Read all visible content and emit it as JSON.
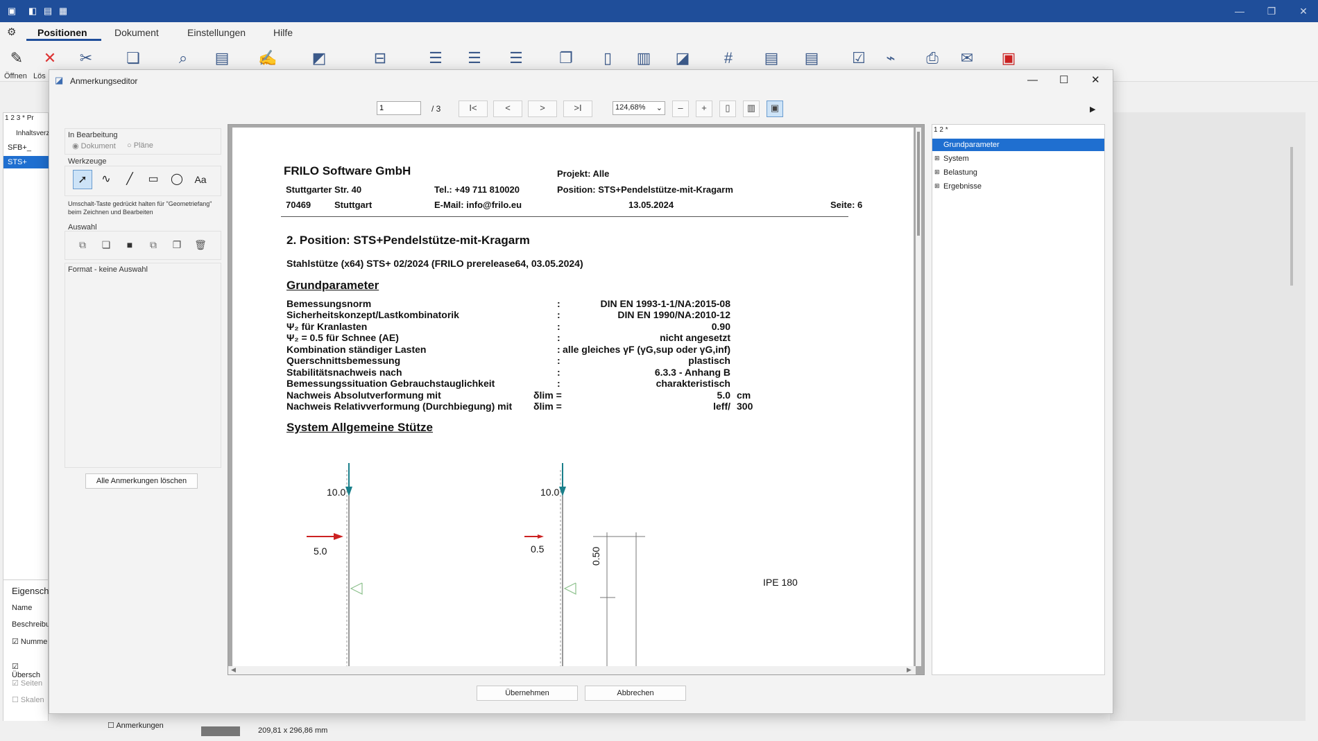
{
  "app": {
    "menu": [
      "Positionen",
      "Dokument",
      "Einstellungen",
      "Hilfe"
    ],
    "ribbon_labels": [
      "Öffnen",
      "Lös"
    ],
    "left_tabs": [
      "1",
      "2",
      "3",
      "*",
      "Pr"
    ],
    "left_tree": [
      "Inhaltsverz",
      "SFB+_",
      "STS+"
    ],
    "properties": {
      "title": "Eigensch",
      "rows": [
        "Name",
        "Beschreibu",
        "Numme",
        "Übersch",
        "Seiten",
        "Skalen"
      ]
    },
    "status": {
      "annotations_label": "Anmerkungen",
      "page_size": "209,81 x 296,86 mm"
    }
  },
  "dialog": {
    "title": "Anmerkungseditor",
    "toolbar": {
      "page_input": "1",
      "page_total": "/ 3",
      "zoom": "124,68%",
      "first": "I<",
      "prev": "<",
      "next": ">",
      "last": ">I",
      "minus": "–",
      "plus": "+"
    },
    "tools": {
      "in_bearbeitung": "In Bearbeitung",
      "radio_dokument": "Dokument",
      "radio_plaene": "Pläne",
      "werkzeuge": "Werkzeuge",
      "text_tool": "Aa",
      "hint_line1": "Umschalt-Taste gedrückt halten für \"Geometriefang\"",
      "hint_line2": "beim Zeichnen und  Bearbeiten",
      "auswahl": "Auswahl",
      "format": "Format - keine Auswahl",
      "clear_button": "Alle Anmerkungen löschen"
    },
    "tree": {
      "tabs": [
        "1",
        "2",
        "*"
      ],
      "items": [
        "Grundparameter",
        "System",
        "Belastung",
        "Ergebnisse"
      ]
    },
    "buttons": {
      "ok": "Übernehmen",
      "cancel": "Abbrechen"
    }
  },
  "document": {
    "company": "FRILO Software GmbH",
    "street": "Stuttgarter Str. 40",
    "zip": "70469",
    "city": "Stuttgart",
    "tel": "Tel.: +49 711 810020",
    "email": "E-Mail: info@frilo.eu",
    "projekt": "Projekt: Alle",
    "position": "Position: STS+Pendelstütze-mit-Kragarm",
    "date": "13.05.2024",
    "seite": "Seite: 6",
    "section_title": "2. Position: STS+Pendelstütze-mit-Kragarm",
    "subtitle": "Stahlstütze (x64) STS+ 02/2024 (FRILO prerelease64, 03.05.2024)",
    "grund_heading": "Grundparameter",
    "params": [
      {
        "label": "Bemessungsnorm",
        "sep": ":",
        "value": "DIN EN 1993-1-1/NA:2015-08"
      },
      {
        "label": "Sicherheitskonzept/Lastkombinatorik",
        "sep": ":",
        "value": "DIN EN 1990/NA:2010-12"
      },
      {
        "label": "Ψ₂ für Kranlasten",
        "sep": ":",
        "value": "0.90"
      },
      {
        "label": "Ψ₂ = 0.5 für Schnee (AE)",
        "sep": ":",
        "value": "nicht angesetzt"
      },
      {
        "label": "Kombination ständiger Lasten",
        "sep": ":",
        "value": "alle gleiches γF (γG,sup oder γG,inf)"
      },
      {
        "label": "Querschnittsbemessung",
        "sep": ":",
        "value": "plastisch"
      },
      {
        "label": "Stabilitätsnachweis nach",
        "sep": ":",
        "value": "6.3.3 - Anhang B"
      },
      {
        "label": "Bemessungssituation Gebrauchstauglichkeit",
        "sep": ":",
        "value": "charakteristisch"
      },
      {
        "label": "Nachweis Absolutverformung mit",
        "sep": "δlim  =",
        "value": "5.0",
        "unit": "cm"
      },
      {
        "label": "Nachweis Relativverformung (Durchbiegung) mit",
        "sep": "δlim  =",
        "value": "leff/",
        "unit": "300"
      }
    ],
    "system_heading": "System Allgemeine Stütze",
    "drawing": {
      "load_left_vertical": "10.0",
      "load_right_vertical": "10.0",
      "load_left_horizontal": "5.0",
      "load_right_horizontal": "0.5",
      "dim": "0.50",
      "profile": "IPE 180"
    }
  }
}
